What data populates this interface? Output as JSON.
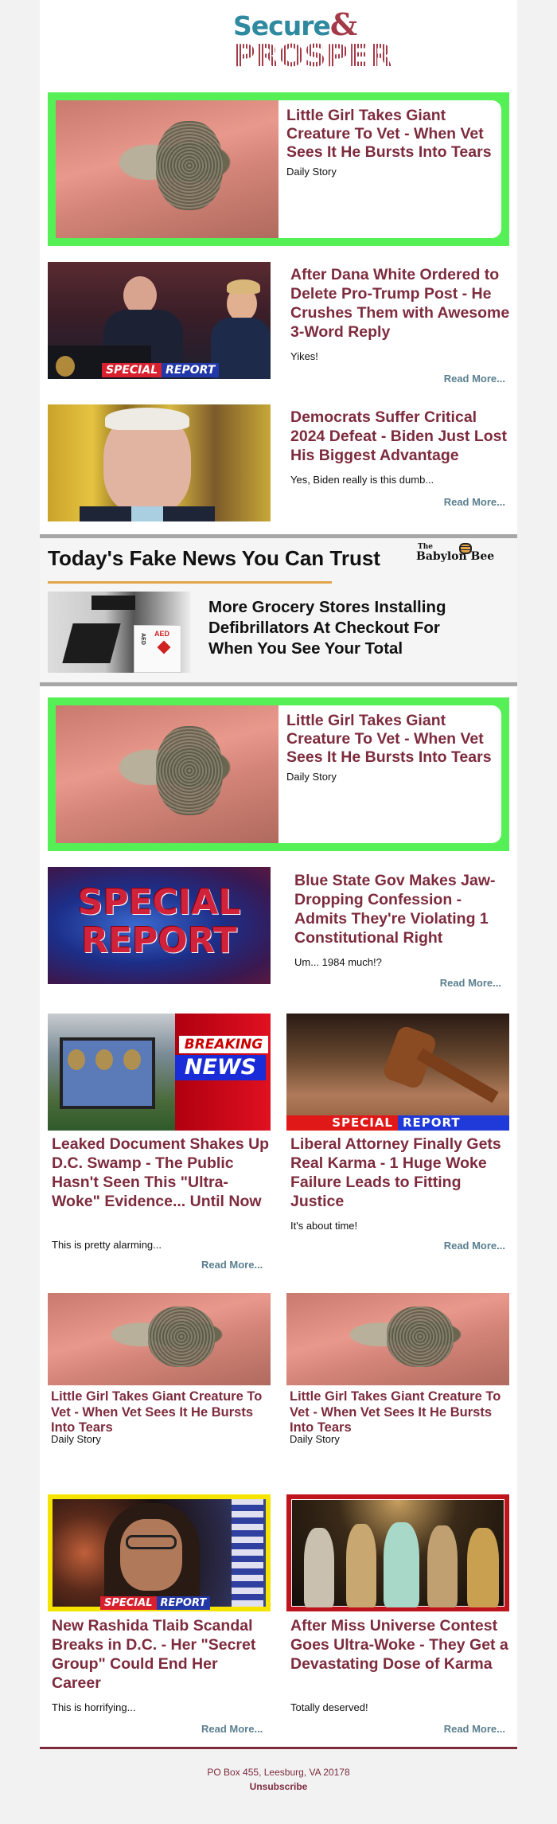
{
  "brand": {
    "logo_line1": "Secure",
    "logo_amp": "&",
    "logo_line2": "PROSPER",
    "headline_color": "#7d2b3d",
    "readmore_color": "#5a7f8f",
    "promo_border_color": "#55f055"
  },
  "promo_top": {
    "title": "Little Girl Takes Giant Creature To Vet - When Vet Sees It He Bursts Into Tears",
    "source": "Daily Story",
    "image": "insect-with-eggs-photo"
  },
  "stories_top": [
    {
      "title": "After Dana White Ordered to Delete Pro-Trump Post - He Crushes Them with Awesome 3-Word Reply",
      "teaser": "Yikes!",
      "read_more": "Read More...",
      "image_badge": [
        "SPECIAL",
        "REPORT"
      ]
    },
    {
      "title": "Democrats Suffer Critical 2024 Defeat - Biden Just Lost His Biggest Advantage",
      "teaser": "Yes, Biden really is this dumb...",
      "read_more": "Read More..."
    }
  ],
  "babylon_bee": {
    "heading": "Today's Fake News You Can Trust",
    "logo_the": "The",
    "logo_name": "Babylon Bee",
    "story_title": "More Grocery Stores Installing Defibrillators At Checkout For When You See Your Total",
    "image_labels": [
      "AED",
      "AED"
    ]
  },
  "promo_mid": {
    "title": "Little Girl Takes Giant Creature To Vet - When Vet Sees It He Bursts Into Tears",
    "source": "Daily Story"
  },
  "story_blue_state": {
    "title": "Blue State Gov Makes Jaw-Dropping Confession - Admits They're Violating 1 Constitutional Right",
    "teaser": "Um... 1984 much!?",
    "read_more": "Read More...",
    "image_text": [
      "SPECIAL",
      "REPORT"
    ]
  },
  "grid_row1": [
    {
      "title": "Leaked Document Shakes Up D.C. Swamp - The Public Hasn't Seen This \"Ultra-Woke\" Evidence... Until Now",
      "teaser": "This is pretty alarming...",
      "read_more": "Read More...",
      "image_badge": [
        "BREAKING",
        "NEWS"
      ]
    },
    {
      "title": "Liberal Attorney Finally Gets Real Karma - 1 Huge Woke Failure Leads to Fitting Justice",
      "teaser": "It's about time!",
      "read_more": "Read More...",
      "image_badge": [
        "SPECIAL",
        "REPORT"
      ]
    }
  ],
  "grid_row2": [
    {
      "title": "Little Girl Takes Giant Creature To Vet - When Vet Sees It He Bursts Into Tears",
      "source": "Daily Story"
    },
    {
      "title": "Little Girl Takes Giant Creature To Vet - When Vet Sees It He Bursts Into Tears",
      "source": "Daily Story"
    }
  ],
  "grid_row3": [
    {
      "title": "New Rashida Tlaib Scandal Breaks in D.C. - Her \"Secret Group\" Could End Her Career",
      "teaser": "This is horrifying...",
      "read_more": "Read More...",
      "image_badge": [
        "SPECIAL",
        "REPORT"
      ],
      "frame_color": "#f5e400"
    },
    {
      "title": "After Miss Universe Contest Goes Ultra-Woke - They Get a Devastating Dose of Karma",
      "teaser": "Totally deserved!",
      "read_more": "Read More...",
      "frame_color": "#c0141c"
    }
  ],
  "footer": {
    "address": "PO Box 455, Leesburg, VA 20178",
    "unsubscribe": "Unsubscribe"
  }
}
